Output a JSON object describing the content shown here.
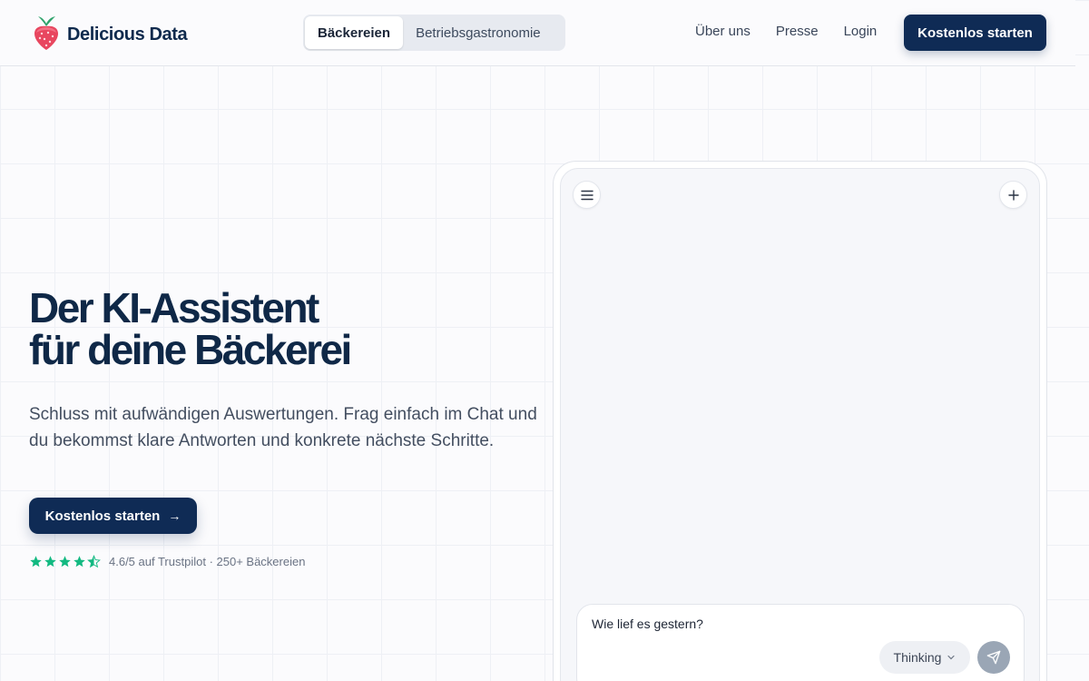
{
  "header": {
    "brand": "Delicious Data",
    "segments": [
      {
        "label": "Bäckereien",
        "active": true
      },
      {
        "label": "Betriebsgastronomie",
        "active": false
      }
    ],
    "nav": [
      "Über uns",
      "Presse",
      "Login"
    ],
    "cta_label": "Kostenlos starten"
  },
  "hero": {
    "title_line1": "Der KI-Assistent",
    "title_line2": "für deine Bäckerei",
    "subtitle": "Schluss mit aufwändigen Auswertungen. Frag einfach im Chat und du bekommst klare Antworten und konkrete nächste Schritte.",
    "cta_label": "Kostenlos starten",
    "cta_icon": "arrow-right-icon",
    "rating_value": 4.5,
    "rating_max": 5,
    "rating_text": "4.6/5 auf Trustpilot · 250+ Bäckereien"
  },
  "chat": {
    "menu_icon": "menu-icon",
    "new_chat_icon": "plus-icon",
    "input_text": "Wie lief es gestern?",
    "mode_label": "Thinking",
    "send_icon": "send-icon"
  },
  "colors": {
    "brand_navy": "#0f2b55",
    "title": "#0f2847",
    "star_green": "#12b981",
    "logo_red": "#e8465f",
    "logo_green": "#2fa36b"
  }
}
